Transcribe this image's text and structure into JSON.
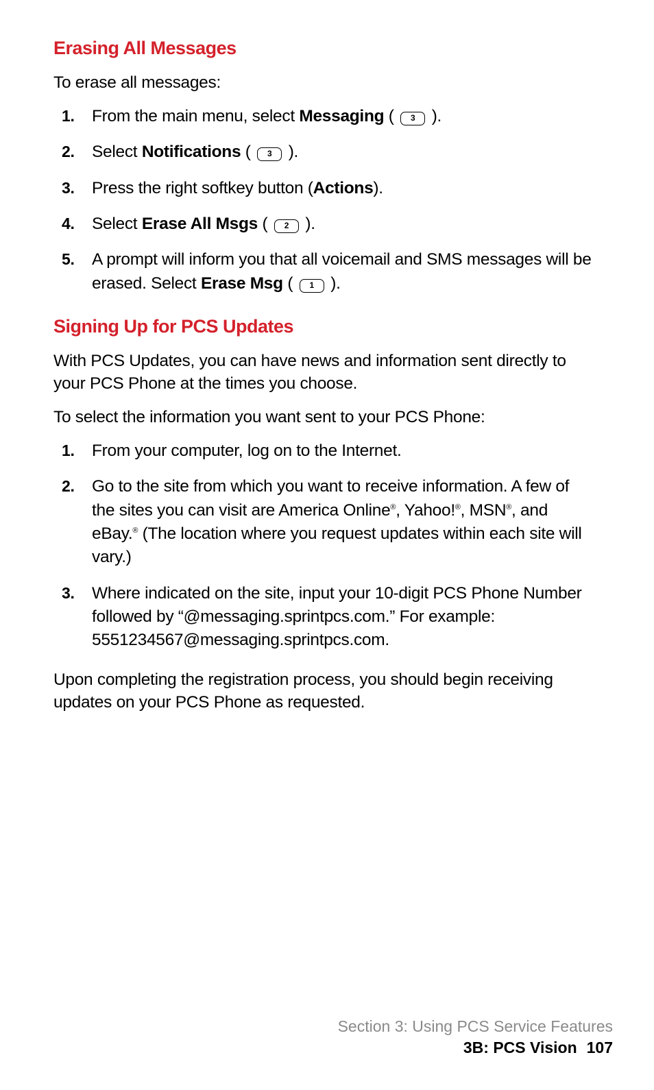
{
  "colors": {
    "accent": "#d4212b"
  },
  "section1": {
    "heading": "Erasing All Messages",
    "intro": "To erase all messages:",
    "steps": [
      {
        "num": "1.",
        "pre": "From the main menu, select ",
        "bold": "Messaging",
        "post1": " (",
        "key": "3",
        "post2": ")."
      },
      {
        "num": "2.",
        "pre": "Select ",
        "bold": "Notifications",
        "post1": " (",
        "key": "3",
        "post2": ")."
      },
      {
        "num": "3.",
        "pre": "Press the right softkey button (",
        "bold": "Actions",
        "post1": ").",
        "key": null,
        "post2": ""
      },
      {
        "num": "4.",
        "pre": "Select ",
        "bold": "Erase All Msgs",
        "post1": " (",
        "key": "2",
        "post2": ")."
      },
      {
        "num": "5.",
        "pre": "A prompt will inform you that all voicemail and SMS messages will be erased. Select ",
        "bold": "Erase Msg",
        "post1": " (",
        "key": "1",
        "post2": ")."
      }
    ]
  },
  "section2": {
    "heading": "Signing Up for PCS Updates",
    "para1": "With PCS Updates, you can have news and information sent directly to your PCS Phone at the times you choose.",
    "para2": "To select the information you want sent to your PCS Phone:",
    "steps": [
      {
        "num": "1.",
        "text": "From your computer, log on to the Internet."
      },
      {
        "num": "2.",
        "t1": "Go to the site from which you want to receive information. A few of the sites you can visit are America Online",
        "t2": ", Yahoo!",
        "t3": ", MSN",
        "t4": ", and eBay.",
        "t5": " (The location where you request updates within each site will vary.)",
        "reg": "®"
      },
      {
        "num": "3.",
        "text": "Where indicated on the site, input your 10-digit PCS Phone Number followed by “@messaging.sprintpcs.com.” For example: 5551234567@messaging.sprintpcs.com."
      }
    ],
    "closing": "Upon completing the registration process, you should begin receiving updates on your PCS Phone as requested."
  },
  "footer": {
    "line1": "Section 3: Using PCS Service Features",
    "line2a": "3B: PCS Vision",
    "page": "107"
  }
}
